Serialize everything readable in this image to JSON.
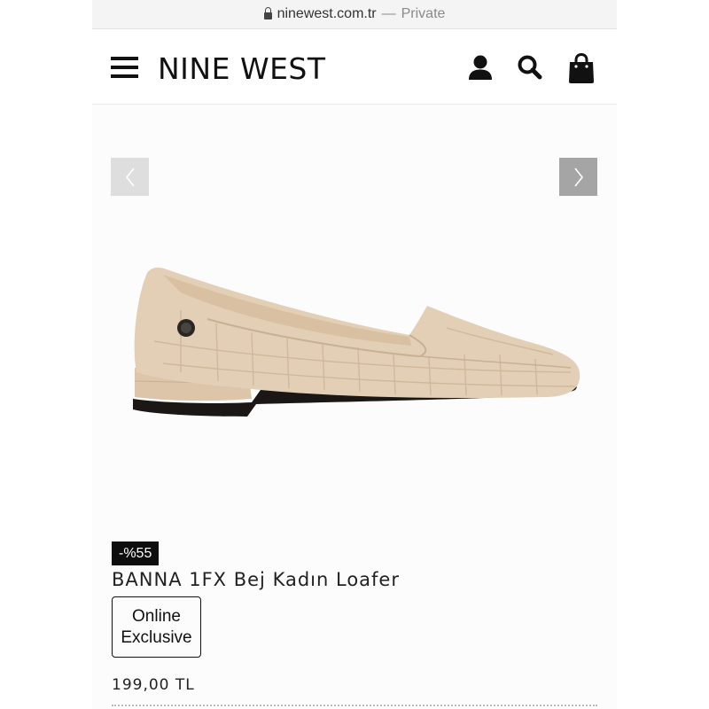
{
  "browser": {
    "domain": "ninewest.com.tr",
    "separator": "—",
    "mode": "Private"
  },
  "header": {
    "logo": "NINE WEST",
    "icons": [
      "menu-icon",
      "user-icon",
      "search-icon",
      "shopping-bag-icon"
    ]
  },
  "gallery": {
    "prev_icon": "chevron-left-icon",
    "next_icon": "chevron-right-icon",
    "image_alt_icon": "loafer-shoe-image"
  },
  "product": {
    "discount_badge": "-%55",
    "title": "BANNA 1FX Bej Kadın Loafer",
    "exclusive_line1": "Online",
    "exclusive_line2": "Exclusive",
    "price": "199,00 TL"
  },
  "colors": {
    "badge_bg": "#0d0d0d",
    "shoe": "#e3cfb5",
    "text": "#1a1a1a"
  }
}
